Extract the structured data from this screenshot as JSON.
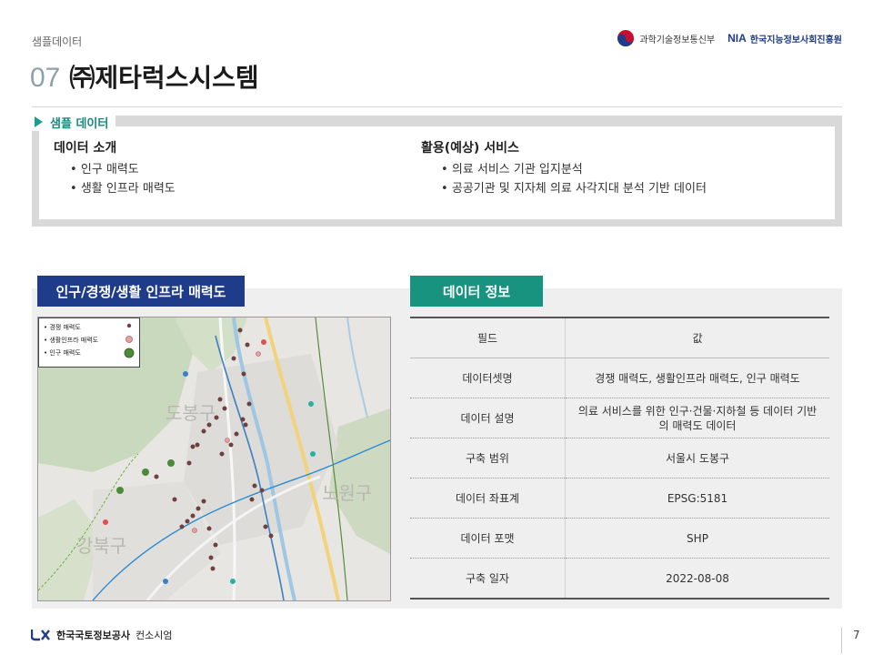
{
  "header": {
    "breadcrumb": "샘플데이터",
    "ministry_logo_text": "과학기술정보통신부",
    "nia_logo_abbr": "NIA",
    "nia_logo_text": "한국지능정보사회진흥원",
    "title_number": "07",
    "title_text": "㈜제타럭스시스템"
  },
  "sample_section": {
    "heading": "샘플 데이터",
    "intro": {
      "title": "데이터 소개",
      "items": [
        "인구 매력도",
        "생활 인프라 매력도"
      ]
    },
    "usage": {
      "title": "활용(예상) 서비스",
      "items": [
        "의료 서비스 기관 입지분석",
        "공공기관 및 지자체 의료 사각지대 분석 기반 데이터"
      ]
    }
  },
  "map_panel": {
    "title": "인구/경쟁/생활 인프라 매력도",
    "legend": [
      "경쟁 매력도",
      "생활인프라 매력도",
      "인구 매력도"
    ],
    "district_labels": [
      "도봉구",
      "노원구",
      "강북구"
    ],
    "colors": {
      "competition": "#7a4a4a",
      "infra": "#e8a0a0",
      "population": "#4c8a3a"
    }
  },
  "info_panel": {
    "title": "데이터 정보",
    "columns": [
      "필드",
      "값"
    ],
    "rows": [
      {
        "field": "데이터셋명",
        "value": "경쟁 매력도, 생활인프라 매력도, 인구 매력도"
      },
      {
        "field": "데이터 설명",
        "value": "의료 서비스를 위한 인구·건물·지하철 등 데이터 기반의 매력도 데이터"
      },
      {
        "field": "구축 범위",
        "value": "서울시 도봉구"
      },
      {
        "field": "데이터 좌표계",
        "value": "EPSG:5181"
      },
      {
        "field": "데이터 포맷",
        "value": "SHP"
      },
      {
        "field": "구축 일자",
        "value": "2022-08-08"
      }
    ]
  },
  "footer": {
    "company": "한국국토정보공사",
    "suffix": "컨소시엄",
    "page_number": "7"
  }
}
